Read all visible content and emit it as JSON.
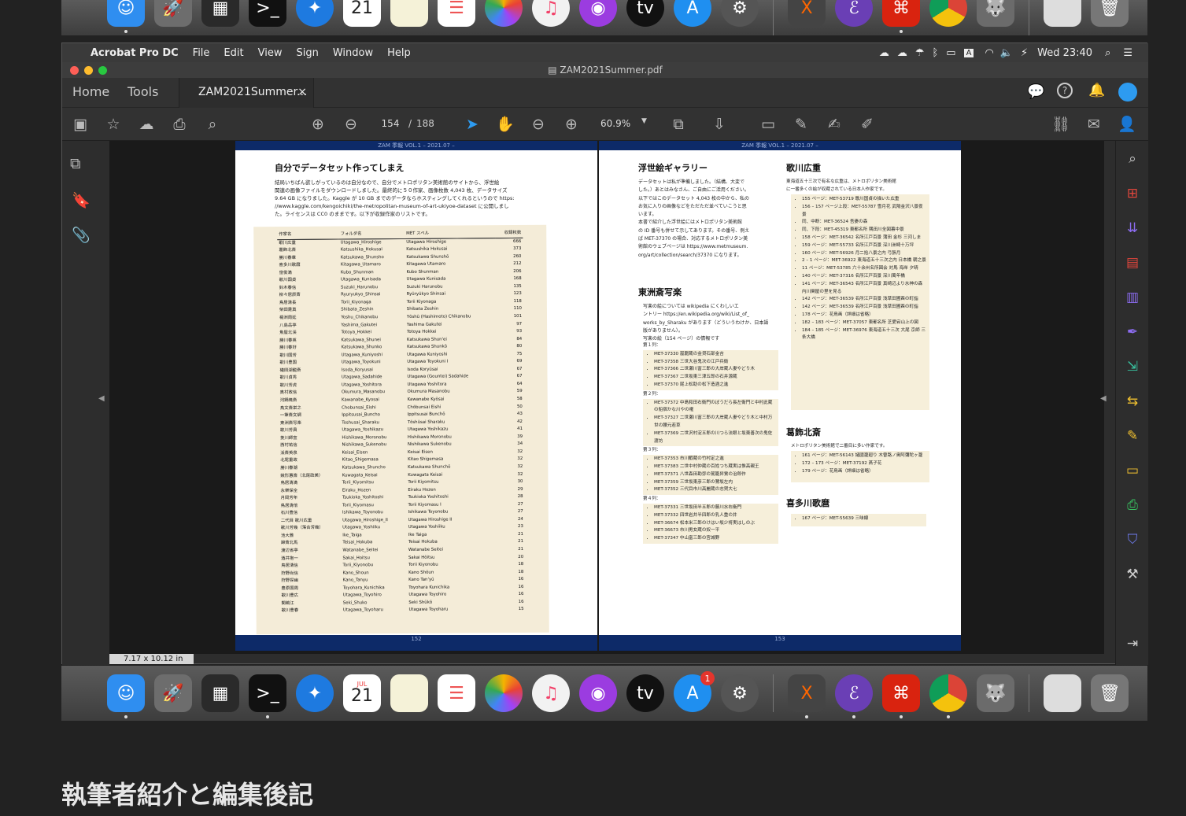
{
  "dock_top": {
    "apps": [
      "finder",
      "launchpad",
      "migration",
      "terminal",
      "safari",
      "calendar",
      "notes",
      "reminders",
      "photos",
      "music",
      "podcasts",
      "appletv",
      "appstore",
      "preferences",
      "xquartz",
      "emacs",
      "acrobat",
      "chrome",
      "gimp",
      "preview",
      "trash"
    ],
    "calendar_day": "21",
    "appletv_label": "tv"
  },
  "dock_bottom": {
    "calendar_month": "JUL",
    "calendar_day": "21",
    "appletv_label": "tv",
    "appstore_badge": "1"
  },
  "menubar": {
    "app_name": "Acrobat Pro DC",
    "items": [
      "File",
      "Edit",
      "View",
      "Sign",
      "Window",
      "Help"
    ],
    "clock": "Wed 23:40",
    "input_indicator": "A"
  },
  "window": {
    "title": "ZAM2021Summer.pdf"
  },
  "tabs": {
    "home": "Home",
    "tools": "Tools",
    "document": "ZAM2021Summer...",
    "close": "×"
  },
  "toolbar": {
    "current_page": "154",
    "page_separator": "/",
    "total_pages": "188",
    "zoom": "60.9%"
  },
  "page_size": "7.17 x 10.12 in",
  "left_page": {
    "header": "ZAM 季報 VOL.1 – 2021.07 –",
    "title": "自分でデータセット作ってしまえ",
    "body": [
      "結局いちばん欲しがっているのは自分なので、自分でメトロポリタン美術館のサイトから、浮世絵",
      "関連の画像ファイルをダウンロードしました。最終的に５０作家、画像枚数 4,043 枚、データサイズ",
      "9.64 GB になりました。Kaggle が 10 GB までのデータならホスティングしてくれるというので https:",
      "//www.kaggle.com/kengoichiki/the-metropolitan-museum-of-art-ukiyoe-dataset に公開しまし",
      "た。ライセンスは CC0 のままです。以下が収録作家のリストです。"
    ],
    "table_headers": [
      "作家名",
      "フォルダ名",
      "MET スペル",
      "収録枚数"
    ],
    "table_rows": [
      [
        "歌川広重",
        "Utagawa_Hiroshige",
        "Utagawa Hiroshige",
        "666"
      ],
      [
        "葛飾北斎",
        "Katsushika_Hokusai",
        "Katsushika Hokusai",
        "373"
      ],
      [
        "勝川春章",
        "Katsukawa_Shunsho",
        "Katsukawa Shunshō",
        "260"
      ],
      [
        "喜多川歌麿",
        "Kitagawa_Utamaro",
        "Kitagawa Utamaro",
        "212"
      ],
      [
        "窪俊満",
        "Kubo_Shunman",
        "Kubo Shunman",
        "206"
      ],
      [
        "歌川国貞",
        "Utagawa_Kunisada",
        "Utagawa Kunisada",
        "168"
      ],
      [
        "鈴木春信",
        "Suzuki_Harunobu",
        "Suzuki Harunobu",
        "135"
      ],
      [
        "柳々居辰斎",
        "Ryuryukyo_Shinsai",
        "Ryūryūkyo Shinsai",
        "123"
      ],
      [
        "鳥居清長",
        "Torii_Kiyonaga",
        "Torii Kiyonaga",
        "118"
      ],
      [
        "柴田是真",
        "Shibata_Zeshin",
        "Shibata Zeshin",
        "110"
      ],
      [
        "楊洲周延",
        "Yoshu_Chikanobu",
        "Yōshū (Hashimoto) Chikanobu",
        "101"
      ],
      [
        "八島岳亭",
        "Yashima_Gakutei",
        "Yashima Gakutei",
        "97"
      ],
      [
        "魚屋北渓",
        "Totoya_Hokkei",
        "Totoya Hokkei",
        "93"
      ],
      [
        "勝川春英",
        "Katsukawa_Shunei",
        "Katsukawa Shun'ei",
        "84"
      ],
      [
        "勝川春好",
        "Katsukawa_Shunko",
        "Katsukawa Shunkō",
        "80"
      ],
      [
        "歌川国芳",
        "Utagawa_Kuniyoshi",
        "Utagawa Kuniyoshi",
        "75"
      ],
      [
        "歌川豊国",
        "Utagawa_Toyokuni",
        "Utagawa Toyokuni I",
        "69"
      ],
      [
        "礒田湖龍斎",
        "Isoda_Koryusai",
        "Isoda Koryūsai",
        "67"
      ],
      [
        "歌川貞秀",
        "Utagawa_Sadahide",
        "Utagawa (Gountei) Sadahide",
        "67"
      ],
      [
        "歌川芳虎",
        "Utagawa_Yoshitora",
        "Utagawa Yoshitora",
        "64"
      ],
      [
        "奥村政信",
        "Okumura_Masanobu",
        "Okumura Masanobu",
        "59"
      ],
      [
        "河鍋暁斎",
        "Kawanabe_Kyosai",
        "Kawanabe Kyōsai",
        "58"
      ],
      [
        "鳥文斎栄之",
        "Chobunsai_Eishi",
        "Chōbunsai Eishi",
        "50"
      ],
      [
        "一筆斎文調",
        "Ippitsusai_Buncho",
        "Ippitsusai Bunchō",
        "43"
      ],
      [
        "東洲斎写楽",
        "Toshusai_Sharaku",
        "Tōshūsai Sharaku",
        "42"
      ],
      [
        "歌川芳員",
        "Utagawa_Yoshikazu",
        "Utagawa Yoshikazu",
        "41"
      ],
      [
        "菱川師宣",
        "Hishikawa_Moronobu",
        "Hishikawa Moronobu",
        "39"
      ],
      [
        "西村祐信",
        "Nishikawa_Sukenobu",
        "Nishikawa Sukenobu",
        "34"
      ],
      [
        "渓斎英泉",
        "Keisai_Eisen",
        "Keisai Eisen",
        "32"
      ],
      [
        "北尾重政",
        "Kitao_Shigemasa",
        "Kitao Shigemasa",
        "32"
      ],
      [
        "勝川春潮",
        "Katsukawa_Shuncho",
        "Katsukawa Shunchō",
        "32"
      ],
      [
        "鍬形蕙斎（北尾政美）",
        "Kuwagata_Keisai",
        "Kuwagata Keisai",
        "32"
      ],
      [
        "鳥居清満",
        "Torii_Kiyomitsu",
        "Torii Kiyomitsu",
        "30"
      ],
      [
        "永樂保全",
        "Eiraku_Hozen",
        "Eiraku Hozen",
        "29"
      ],
      [
        "月岡芳年",
        "Tsukioka_Yoshitoshi",
        "Tsukioka Yoshitoshi",
        "28"
      ],
      [
        "鳥居清倍",
        "Torii_Kiyomasu",
        "Torii Kiyomasu I",
        "27"
      ],
      [
        "石川豊信",
        "Ishikawa_Toyonobu",
        "Ishikawa Toyonobu",
        "27"
      ],
      [
        "二代目 歌川広重",
        "Utagawa_Hiroshige_II",
        "Utagawa Hiroshige II",
        "24"
      ],
      [
        "歌川芳幾（落合芳幾）",
        "Utagawa_Yoshiiku",
        "Utagawa Yoshiiku",
        "23"
      ],
      [
        "池大雅",
        "Ike_Taiga",
        "Ike Taiga",
        "21"
      ],
      [
        "蹄斎北馬",
        "Teisai_Hokuba",
        "Teisai Hokuba",
        "21"
      ],
      [
        "渡辺省亭",
        "Watanabe_Seitei",
        "Watanabe Seitei",
        "21"
      ],
      [
        "酒井抱一",
        "Sakai_Hoitsu",
        "Sakai Hōitsu",
        "20"
      ],
      [
        "鳥居清信",
        "Torii_Kiyonobu",
        "Torii Kiyonobu",
        "18"
      ],
      [
        "狩野尚信",
        "Kano_Shoun",
        "Kano Shōun",
        "18"
      ],
      [
        "狩野探幽",
        "Kano_Tanyu",
        "Kano Tan'yū",
        "16"
      ],
      [
        "豊原国周",
        "Toyohara_Kunichika",
        "Toyohara Kunichika",
        "16"
      ],
      [
        "歌川豊広",
        "Utagawa_Toyohiro",
        "Utagawa Toyohiro",
        "16"
      ],
      [
        "関鵜江",
        "Seki_Shuko",
        "Seki Shūkō",
        "16"
      ],
      [
        "歌川豊春",
        "Utagawa_Toyoharu",
        "Utagawa Toyoharu",
        "15"
      ]
    ],
    "footer": "152"
  },
  "right_page": {
    "header": "ZAM 季報 VOL.1 – 2021.07 –",
    "gallery_title": "浮世絵ギャラリー",
    "gallery_body": [
      "データセットは私が準備しました。（結構、大変で",
      "した。）あとはみなさん、ご自由にご活用ください。",
      "以下ではこのデータセット 4,043 枚の中から、私の",
      "お気に入りの画像などをただただ並べていこうと思",
      "います。",
      "本書で紹介した浮世絵にはメトロポリタン美術館",
      "の ID 番号も併せて示してあります。その番号、例え",
      "ば MET-37370 の場合、対応するメトロポリタン美",
      "術館のウェブページは https://www.metmuseum.",
      "org/art/collection/search/37370 になります。"
    ],
    "sharaku_title": "東洲斎写楽",
    "sharaku_body": [
      "写楽の絵については wikipedia にくわしいエ",
      "ントリー https://en.wikipedia.org/wiki/List_of_",
      "works_by_Sharaku があります（どういうわけか、日本語",
      "版がありません）。",
      "写楽の絵（154 ページ）の情報です"
    ],
    "sharaku_groups": [
      {
        "label": "第１列：",
        "items": [
          "MET-37330 嵐龍蔵の金貸石部金吉",
          "MET-37358 三世大谷鬼次の江戸兵衛",
          "MET-37366 二世瀬川富三郎の大岸蔵人妻やどり木",
          "MET-37367 二世坂東三津五郎の石井源蔵",
          "MET-37370 尾上松助の松下造酒之進"
        ]
      },
      {
        "label": "第２列：",
        "items": [
          "MET-37372 中島和田右衛門のぼうだら長左衛門と中村此蔵の船宿かな川やの権",
          "MET-37327 二世瀬川富三郎の大岸蔵人妻やどり木と中村万世の腰元若草",
          "MET-37369 二世沢村淀五郎の川つら法眼と坂東善次の鬼佐渡坊"
        ]
      },
      {
        "label": "第３列：",
        "items": [
          "MET-37353 市川鰕蔵の竹村定之進",
          "MET-37383 二世中村仲蔵の百姓つち蔵実は惟高親王",
          "MET-37371 八世森田勘弥の駕籠舁鶯の治郎作",
          "MET-37359 三世坂東彦三郎の鷺坂左内",
          "MET-37352 三代目市川高麗蔵の志賀大七"
        ]
      },
      {
        "label": "第４列：",
        "items": [
          "MET-37331 三世坂田半五郎の藤川水右衛門",
          "MET-37332 四世岩井半四郎の乳人重の井",
          "MET-36674 松本米三郎のけはい坂少将実はしのぶ",
          "MET-36673 市川男女蔵の奴一平",
          "MET-37347 中山富三郎の宮城野"
        ]
      }
    ],
    "hiroshige_title": "歌川広重",
    "hiroshige_intro": [
      "東海道五十三次で有名な広重は、メトロポリタン美術館",
      "に一番多くの絵が収蔵されている日本人作家です。"
    ],
    "hiroshige_items": [
      "155 ページ：MET-53719 歌川国貞の描いた広重",
      "156 – 157 ページ上段：MET-55787 雪月花 武陽金沢八景夜景",
      "同、中断：MET-36524 吾妻の森",
      "同、下段：MET-45319 東都名所 隅田川全図暮中景",
      "158 ページ：MET-36542 名所江戸百景 蒲田 金杉 三河しま",
      "159 ページ：MET-55733 名所江戸百景 深川洲崎十万坪",
      "160 ページ：MET-56926 月二拾八景之内 弓張月",
      "2 – 1 ページ：MET-36922 東海道五十三次之内 日本橋 朝之景",
      "11 ページ：MET-53785 六十余州名所図会 対馬 海岸 夕晴",
      "140 ページ：MET-37316 名所江戸百景 深川萬年橋",
      "141 ページ：MET-36543 名所江戸百景 真崎辺より水神の森内川関屋の里を見る",
      "142 ページ：MET-36539 名所江戸百景 浅草田圃酉の町詣",
      "142 ページ：MET-36539 名所江戸百景 浅草田圃酉の町詣",
      "178 ページ：花鳥画（詳細は省略）",
      "182 – 183 ページ：MET-37057 東都名所 芝愛宕山上の図",
      "184 – 185 ページ：MET-36976 東海道五十三次 大尾 京師 三条大橋"
    ],
    "hokusai_title": "葛飾北斎",
    "hokusai_intro": "メトロポリタン美術館で二番目に多い作家です。",
    "hokusai_items": [
      "161 ページ：MET-56143 諸國瀧廻り 木曽路ノ奥阿彌陀ヶ瀧",
      "172 – 173 ページ：MET-37192 燕子花",
      "179 ページ：花鳥画（詳細は省略）"
    ],
    "utamaro_title": "喜多川歌麿",
    "utamaro_items": [
      "167 ページ：MET-55639 三味線"
    ],
    "footer": "153"
  },
  "bottom_caption": "執筆者紹介と編集後記",
  "colors": {
    "page_band": "#0d2a68",
    "accent_blue": "#2d9bf0",
    "right_rail_red": "#e0463c",
    "right_rail_purple": "#8c6cf0"
  }
}
